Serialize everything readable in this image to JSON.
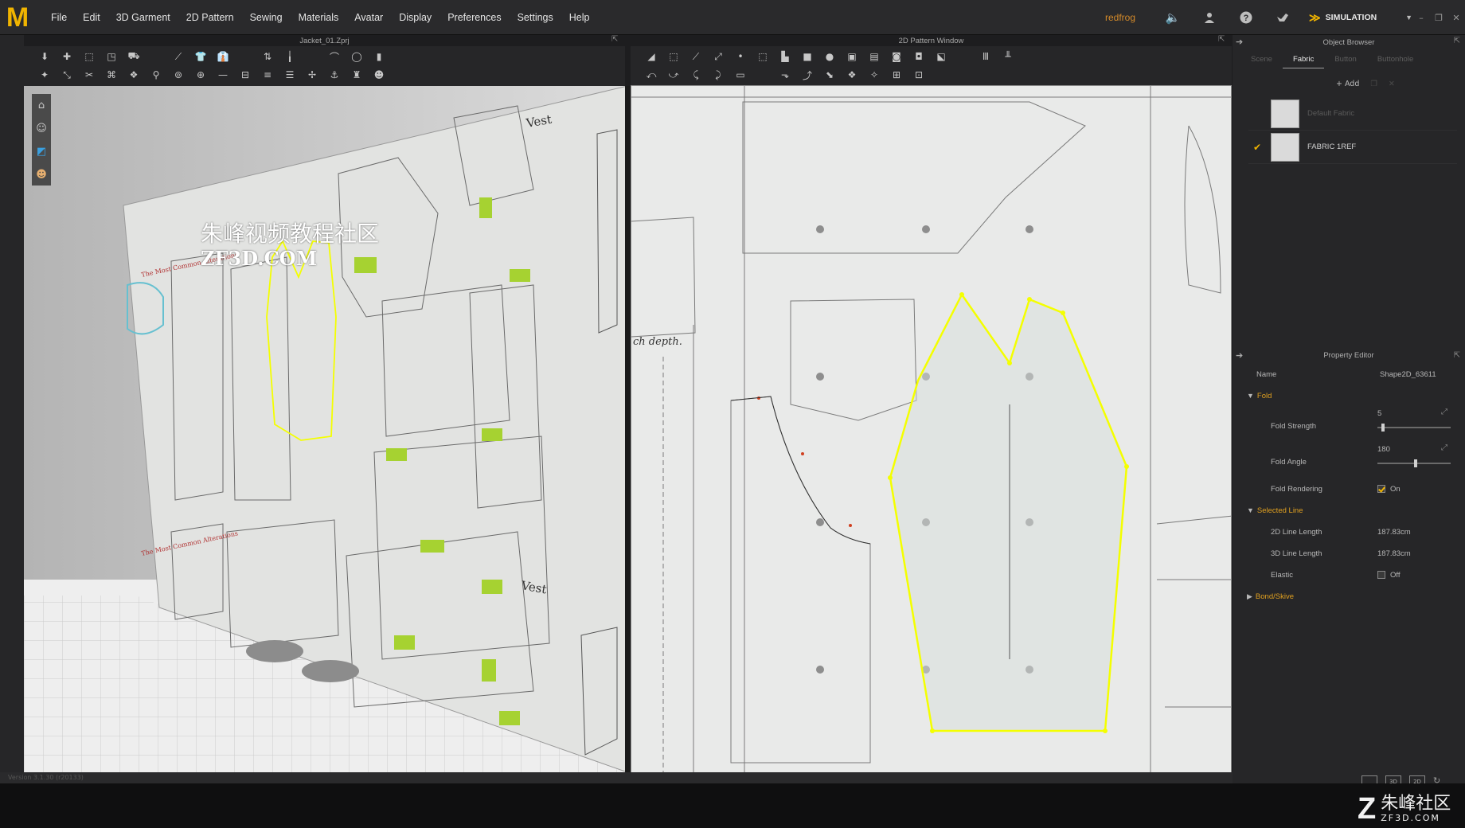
{
  "menubar": {
    "logo": "M",
    "items": [
      "File",
      "Edit",
      "3D Garment",
      "2D Pattern",
      "Sewing",
      "Materials",
      "Avatar",
      "Display",
      "Preferences",
      "Settings",
      "Help"
    ],
    "user": "redfrog",
    "mode": "SIMULATION"
  },
  "view3d": {
    "title": "Jacket_01.Zprj",
    "pattern_labels": {
      "vest_top": "Vest",
      "vest_bottom": "Vest",
      "heading_top": "The Most Common Alterations",
      "heading_mid": "The Most Common Alterations"
    }
  },
  "view2d": {
    "title": "2D Pattern Window",
    "annotation": "ch depth."
  },
  "object_browser": {
    "title": "Object Browser",
    "tabs": [
      "Scene",
      "Fabric",
      "Button",
      "Buttonhole"
    ],
    "active_tab": "Fabric",
    "add_label": "+ Add",
    "fabrics": [
      {
        "name": "Default Fabric",
        "selected": false
      },
      {
        "name": "FABRIC 1REF",
        "selected": true
      }
    ]
  },
  "property_editor": {
    "title": "Property Editor",
    "name_label": "Name",
    "name_value": "Shape2D_63611",
    "fold_section": "Fold",
    "fold_strength_label": "Fold Strength",
    "fold_strength_value": "5",
    "fold_strength_level": 0.05,
    "fold_angle_label": "Fold Angle",
    "fold_angle_value": "180",
    "fold_angle_level": 0.5,
    "fold_rendering_label": "Fold Rendering",
    "fold_rendering_value": "On",
    "selected_line_section": "Selected Line",
    "line2d_label": "2D Line Length",
    "line2d_value": "187.83cm",
    "line3d_label": "3D Line Length",
    "line3d_value": "187.83cm",
    "elastic_label": "Elastic",
    "elastic_value": "Off",
    "bond_section": "Bond/Skive"
  },
  "watermark": {
    "cn": "朱峰视频教程社区",
    "url": "ZF3D.COM",
    "corner_cn": "朱峰社区",
    "corner_url": "ZF3D.COM"
  },
  "status": {
    "text": "Version 3.1.30 (r20133)"
  },
  "colors": {
    "accent": "#f0b400",
    "user": "#d48a2a",
    "selection": "#f4ff00"
  }
}
